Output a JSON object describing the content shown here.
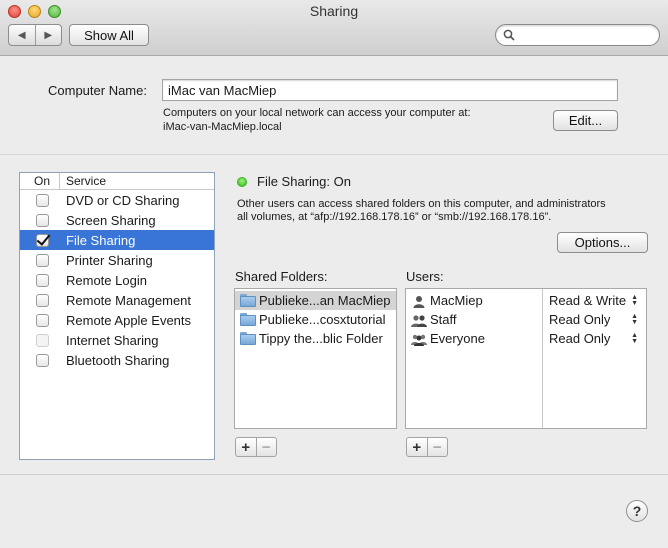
{
  "window": {
    "title": "Sharing"
  },
  "toolbar": {
    "show_all_label": "Show All",
    "search_placeholder": ""
  },
  "computer": {
    "name_label": "Computer Name:",
    "name_value": "iMac van MacMiep",
    "access_line1": "Computers on your local network can access your computer at:",
    "access_line2": "iMac-van-MacMiep.local",
    "edit_label": "Edit..."
  },
  "services": {
    "col_on": "On",
    "col_service": "Service",
    "items": [
      {
        "label": "DVD or CD Sharing",
        "checked": false,
        "enabled": true,
        "selected": false
      },
      {
        "label": "Screen Sharing",
        "checked": false,
        "enabled": true,
        "selected": false
      },
      {
        "label": "File Sharing",
        "checked": true,
        "enabled": true,
        "selected": true
      },
      {
        "label": "Printer Sharing",
        "checked": false,
        "enabled": true,
        "selected": false
      },
      {
        "label": "Remote Login",
        "checked": false,
        "enabled": true,
        "selected": false
      },
      {
        "label": "Remote Management",
        "checked": false,
        "enabled": true,
        "selected": false
      },
      {
        "label": "Remote Apple Events",
        "checked": false,
        "enabled": true,
        "selected": false
      },
      {
        "label": "Internet Sharing",
        "checked": false,
        "enabled": false,
        "selected": false
      },
      {
        "label": "Bluetooth Sharing",
        "checked": false,
        "enabled": true,
        "selected": false
      }
    ]
  },
  "detail": {
    "status": "File Sharing: On",
    "status_color": "#34b51d",
    "desc_line1": "Other users can access shared folders on this computer, and administrators",
    "desc_line2": "all volumes, at “afp://192.168.178.16” or “smb://192.168.178.16”.",
    "options_label": "Options...",
    "shared_folders_label": "Shared Folders:",
    "users_label": "Users:",
    "folders": [
      {
        "label": "Publieke...an MacMiep",
        "icon": "folder-icon",
        "selected": true
      },
      {
        "label": "Publieke...cosxtutorial",
        "icon": "public-folder-icon",
        "selected": false
      },
      {
        "label": "Tippy the...blic Folder",
        "icon": "folder-icon",
        "selected": false
      }
    ],
    "users": [
      {
        "name": "MacMiep",
        "icon": "single-user-icon",
        "permission": "Read & Write"
      },
      {
        "name": "Staff",
        "icon": "group-icon",
        "permission": "Read Only"
      },
      {
        "name": "Everyone",
        "icon": "everyone-icon",
        "permission": "Read Only"
      }
    ],
    "add_label": "+",
    "remove_label": "−"
  },
  "help_label": "?"
}
